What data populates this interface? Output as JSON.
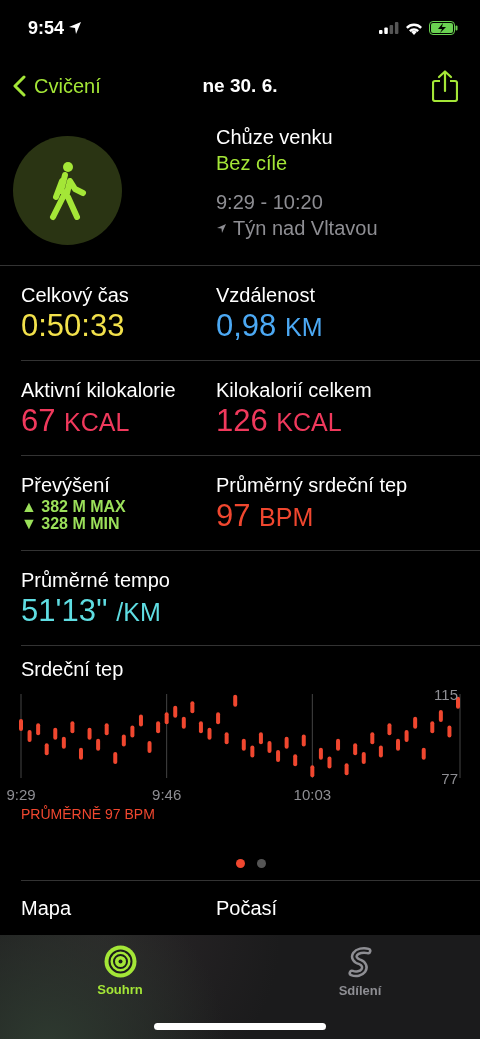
{
  "status_bar": {
    "time": "9:54"
  },
  "nav": {
    "back": "Cvičení",
    "title": "ne 30. 6."
  },
  "workout": {
    "type": "Chůze venku",
    "goal": "Bez cíle",
    "time_range": "9:29 - 10:20",
    "location": "Týn nad Vltavou"
  },
  "metrics": [
    {
      "kind": "value",
      "label": "Celkový čas",
      "value": "0:50:33",
      "color": "#f2e14b"
    },
    {
      "kind": "value",
      "label": "Vzdálenost",
      "value": "0,98",
      "unit": "KM",
      "color": "#4ca9f4"
    },
    {
      "kind": "value",
      "label": "Aktivní kilokalorie",
      "value": "67",
      "unit": "KCAL",
      "color": "#f0395c"
    },
    {
      "kind": "value",
      "label": "Kilokalorií celkem",
      "value": "126",
      "unit": "KCAL",
      "color": "#f0395c"
    },
    {
      "kind": "elevation",
      "label": "Převýšení",
      "lines": [
        "▲ 382 M MAX",
        "▼ 328 M MIN"
      ],
      "color": "#9be05a"
    },
    {
      "kind": "value",
      "label": "Průměrný srdeční tep",
      "value": "97",
      "unit": "BPM",
      "color": "#f0472f"
    },
    {
      "kind": "value",
      "label": "Průměrné tempo",
      "value": "51'13''",
      "unit": "/KM",
      "color": "#5fdde2"
    }
  ],
  "heart_rate": {
    "average": "PRŮMĚRNĚ 97 BPM",
    "chart_data": {
      "type": "scatter",
      "title": "Srdeční tep",
      "categories": [
        "9:29",
        null,
        null,
        null,
        null,
        null,
        null,
        null,
        null,
        null,
        null,
        null,
        null,
        null,
        null,
        null,
        null,
        "9:46",
        null,
        null,
        null,
        null,
        null,
        null,
        null,
        null,
        null,
        null,
        null,
        null,
        null,
        null,
        null,
        null,
        "10:03",
        null,
        null,
        null,
        null,
        null,
        null,
        null,
        null,
        null,
        null,
        null,
        null,
        null,
        null,
        null,
        null,
        null
      ],
      "series": [
        {
          "color": "#f0472f",
          "values": [
            101,
            96,
            99,
            90,
            97,
            93,
            100,
            88,
            97,
            92,
            99,
            86,
            94,
            98,
            103,
            91,
            100,
            104,
            107,
            102,
            109,
            100,
            97,
            104,
            95,
            112,
            92,
            89,
            95,
            91,
            87,
            93,
            85,
            94,
            80,
            88,
            84,
            92,
            81,
            90,
            86,
            95,
            89,
            99,
            92,
            96,
            102,
            88,
            100,
            105,
            98,
            111
          ]
        }
      ],
      "ylim": [
        77,
        115
      ],
      "grid": true,
      "yticks": [
        {
          "value": 115,
          "label": "115"
        },
        {
          "value": 77,
          "label": "77"
        }
      ]
    }
  },
  "pager": [
    {
      "selected": true
    },
    {
      "selected": false
    }
  ],
  "sections": [
    "Mapa",
    "Počasí"
  ],
  "tabs": [
    {
      "label": "Souhrn",
      "selected": true
    },
    {
      "label": "Sdílení",
      "selected": false
    }
  ]
}
